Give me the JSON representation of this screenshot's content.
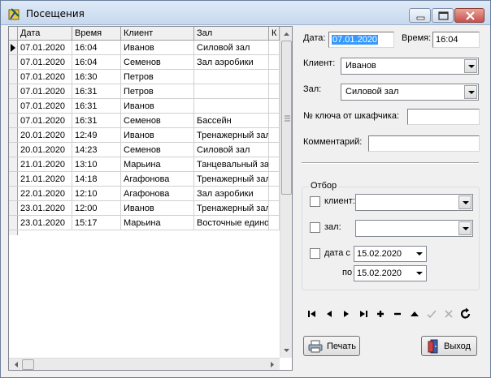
{
  "window": {
    "title": "Посещения"
  },
  "grid": {
    "columns": [
      "Дата",
      "Время",
      "Клиент",
      "Зал",
      "К"
    ],
    "rows": [
      [
        "07.01.2020",
        "16:04",
        "Иванов",
        "Силовой зал"
      ],
      [
        "07.01.2020",
        "16:04",
        "Семенов",
        "Зал аэробики"
      ],
      [
        "07.01.2020",
        "16:30",
        "Петров",
        ""
      ],
      [
        "07.01.2020",
        "16:31",
        "Петров",
        ""
      ],
      [
        "07.01.2020",
        "16:31",
        "Иванов",
        ""
      ],
      [
        "07.01.2020",
        "16:31",
        "Семенов",
        "Бассейн"
      ],
      [
        "20.01.2020",
        "12:49",
        "Иванов",
        "Тренажерный зал"
      ],
      [
        "20.01.2020",
        "14:23",
        "Семенов",
        "Силовой зал"
      ],
      [
        "21.01.2020",
        "13:10",
        "Марьина",
        "Танцевальный зал"
      ],
      [
        "21.01.2020",
        "14:18",
        "Агафонова",
        "Тренажерный зал"
      ],
      [
        "22.01.2020",
        "12:10",
        "Агафонова",
        "Зал аэробики"
      ],
      [
        "23.01.2020",
        "12:00",
        "Иванов",
        "Тренажерный зал"
      ],
      [
        "23.01.2020",
        "15:17",
        "Марьина",
        "Восточные едино"
      ]
    ]
  },
  "form": {
    "date_label": "Дата:",
    "date_value": "07.01.2020",
    "time_label": "Время:",
    "time_value": "16:04",
    "client_label": "Клиент:",
    "client_value": "Иванов",
    "hall_label": "Зал:",
    "hall_value": "Силовой зал",
    "locker_label": "№ ключа от шкафчика:",
    "locker_value": "",
    "comment_label": "Комментарий:",
    "comment_value": ""
  },
  "filter": {
    "title": "Отбор",
    "client_label": "клиент:",
    "client_value": "",
    "hall_label": "зал:",
    "hall_value": "",
    "date_from_label": "дата с",
    "date_from_value": "15.02.2020",
    "date_to_label": "по",
    "date_to_value": "15.02.2020"
  },
  "navigator": [
    "first-icon",
    "prior-icon",
    "next-icon",
    "last-icon",
    "insert-icon",
    "delete-icon",
    "edit-icon",
    "post-icon",
    "cancel-icon",
    "refresh-icon"
  ],
  "buttons": {
    "print_label": "Печать",
    "exit_label": "Выход"
  },
  "colors": {
    "selection": "#3399ff",
    "window_bg": "#f0f0f0"
  }
}
